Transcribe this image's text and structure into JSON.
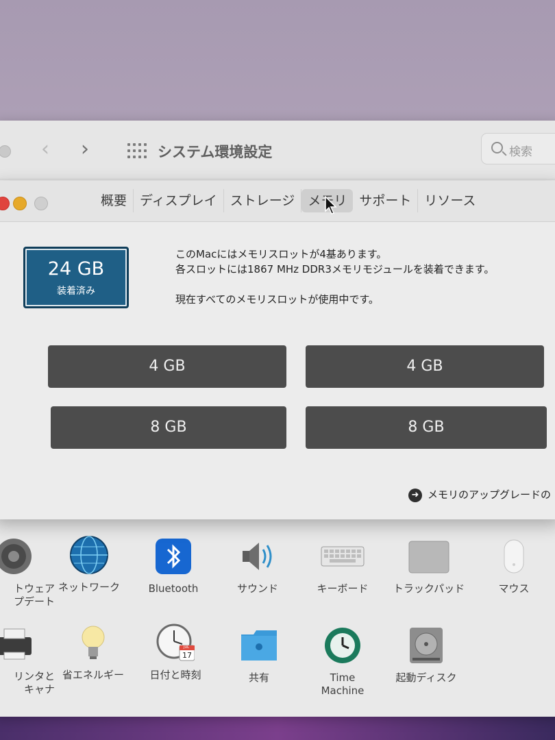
{
  "system_prefs": {
    "title": "システム環境設定",
    "search_placeholder": "検索",
    "row1": [
      {
        "label": "トウェア\nプデート",
        "icon": "software-update-icon"
      },
      {
        "label": "ネットワーク",
        "icon": "network-icon"
      },
      {
        "label": "Bluetooth",
        "icon": "bluetooth-icon"
      },
      {
        "label": "サウンド",
        "icon": "sound-icon"
      },
      {
        "label": "キーボード",
        "icon": "keyboard-icon"
      },
      {
        "label": "トラックパッド",
        "icon": "trackpad-icon"
      },
      {
        "label": "マウス",
        "icon": "mouse-icon"
      }
    ],
    "row2": [
      {
        "label": "リンタと\nキャナ",
        "icon": "printer-icon"
      },
      {
        "label": "省エネルギー",
        "icon": "energy-saver-icon"
      },
      {
        "label": "日付と時刻",
        "icon": "date-time-icon",
        "calendar_day": "17",
        "calendar_month": "JUL"
      },
      {
        "label": "共有",
        "icon": "sharing-icon"
      },
      {
        "label": "Time\nMachine",
        "icon": "time-machine-icon"
      },
      {
        "label": "起動ディスク",
        "icon": "startup-disk-icon"
      }
    ]
  },
  "about": {
    "tabs": [
      "概要",
      "ディスプレイ",
      "ストレージ",
      "メモリ",
      "サポート",
      "リソース"
    ],
    "active_tab": "メモリ",
    "memory": {
      "total": "24 GB",
      "status": "装着済み",
      "line1": "このMacにはメモリスロットが4基あります。",
      "line2": "各スロットには1867 MHz DDR3メモリモジュールを装着できます。",
      "line3": "現在すべてのメモリスロットが使用中です。"
    },
    "slots": [
      "4 GB",
      "4 GB",
      "8 GB",
      "8 GB"
    ],
    "upgrade_link": "メモリのアップグレードの"
  },
  "colors": {
    "badge": "#1f5f86",
    "slot": "#4c4c4c",
    "close": "#e0443e",
    "minimize": "#e6a92a"
  }
}
